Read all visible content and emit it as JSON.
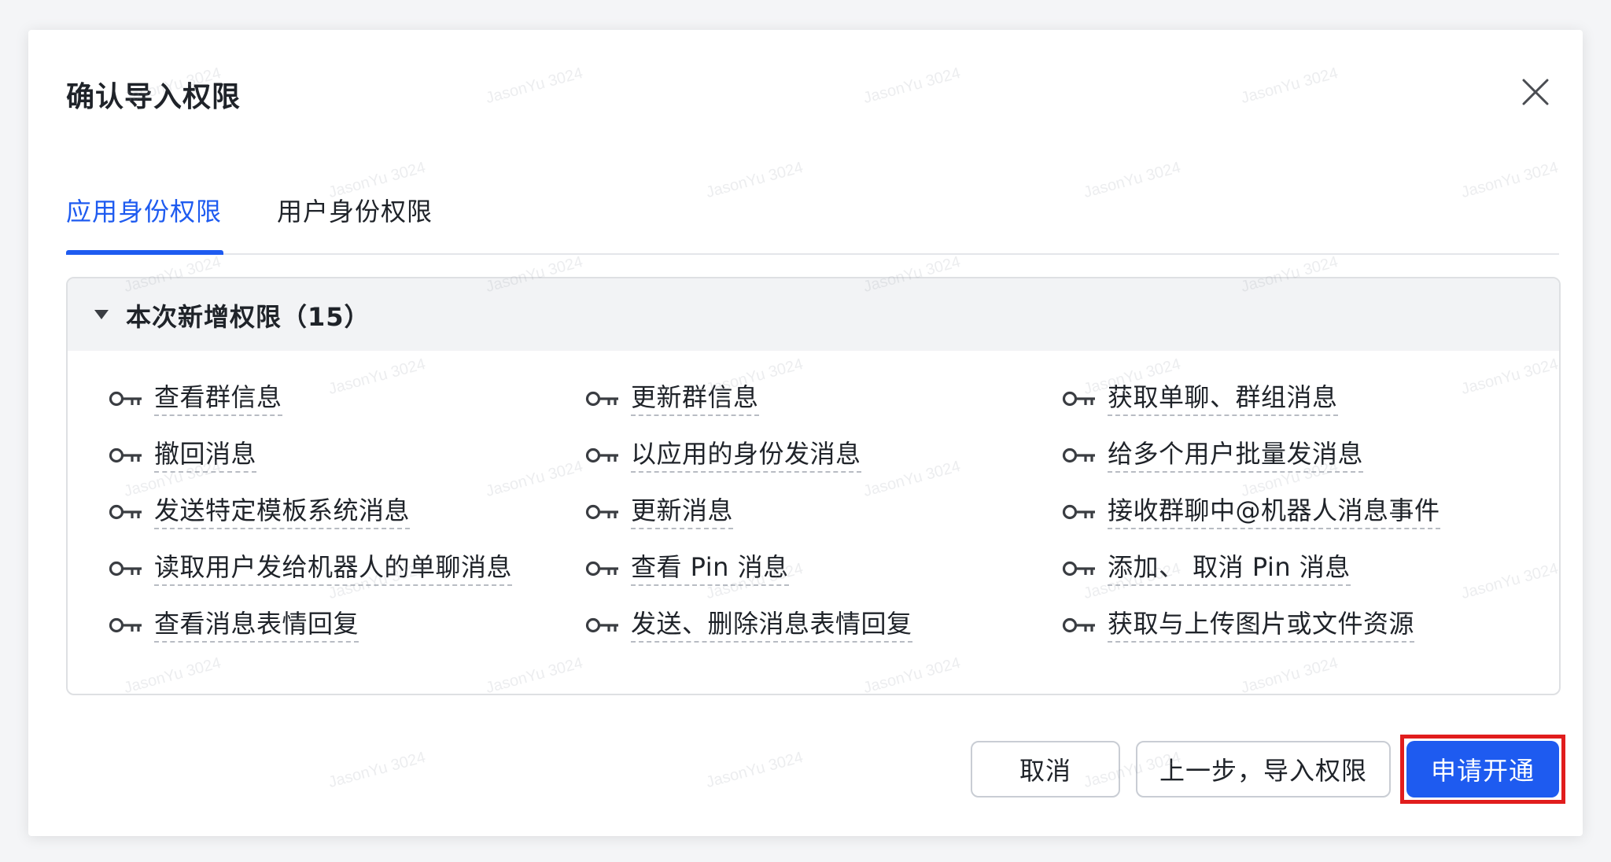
{
  "dialog": {
    "title": "确认导入权限",
    "close_icon": "close-icon"
  },
  "tabs": [
    {
      "label": "应用身份权限",
      "active": true
    },
    {
      "label": "用户身份权限",
      "active": false
    }
  ],
  "panel": {
    "title": "本次新增权限（15）",
    "expanded": true,
    "permissions": [
      [
        "查看群信息",
        "更新群信息",
        "获取单聊、群组消息"
      ],
      [
        "撤回消息",
        "以应用的身份发消息",
        "给多个用户批量发消息"
      ],
      [
        "发送特定模板系统消息",
        "更新消息",
        "接收群聊中@机器人消息事件"
      ],
      [
        "读取用户发给机器人的单聊消息",
        "查看 Pin 消息",
        "添加、 取消 Pin 消息"
      ],
      [
        "查看消息表情回复",
        "发送、删除消息表情回复",
        "获取与上传图片或文件资源"
      ]
    ],
    "permission_icon": "key-icon"
  },
  "footer": {
    "cancel_label": "取消",
    "prev_label": "上一步，导入权限",
    "apply_label": "申请开通"
  },
  "watermark": "JasonYu 3024",
  "colors": {
    "accent": "#1e5bf0",
    "highlight": "#e11d1d",
    "text": "#1f2329"
  }
}
